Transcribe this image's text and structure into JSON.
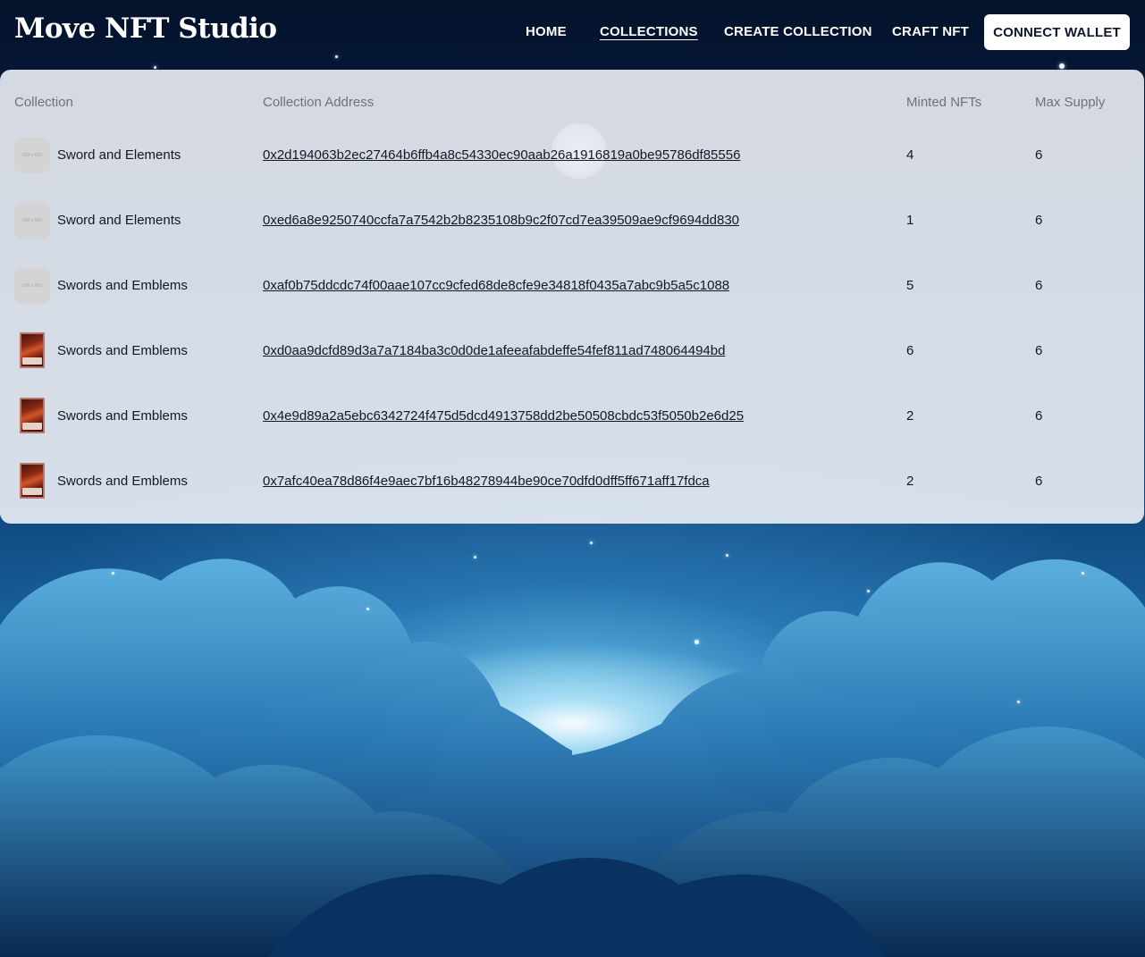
{
  "app": {
    "title": "Move NFT Studio"
  },
  "nav": {
    "home": "HOME",
    "collections": "COLLECTIONS",
    "create_collection": "CREATE COLLECTION",
    "craft_nft": "CRAFT NFT",
    "connect_wallet": "CONNECT WALLET",
    "active": "COLLECTIONS"
  },
  "table": {
    "headers": {
      "collection": "Collection",
      "address": "Collection Address",
      "minted": "Minted NFTs",
      "max_supply": "Max Supply"
    },
    "placeholder_text": "600 x 600",
    "rows": [
      {
        "name": "Sword and Elements",
        "address": "0x2d194063b2ec27464b6ffb4a8c54330ec90aab26a1916819a0be95786df85556",
        "minted": "4",
        "max_supply": "6",
        "image": "placeholder"
      },
      {
        "name": "Sword and Elements",
        "address": "0xed6a8e9250740ccfa7a7542b2b8235108b9c2f07cd7ea39509ae9cf9694dd830",
        "minted": "1",
        "max_supply": "6",
        "image": "placeholder"
      },
      {
        "name": "Swords and Emblems",
        "address": "0xaf0b75ddcdc74f00aae107cc9cfed68de8cfe9e34818f0435a7abc9b5a5c1088",
        "minted": "5",
        "max_supply": "6",
        "image": "placeholder"
      },
      {
        "name": "Swords and Emblems",
        "address": "0xd0aa9dcfd89d3a7a7184ba3c0d0de1afeeafabdeffe54fef811ad748064494bd",
        "minted": "6",
        "max_supply": "6",
        "image": "card-art"
      },
      {
        "name": "Swords and Emblems",
        "address": "0x4e9d89a2a5ebc6342724f475d5dcd4913758dd2be50508cbdc53f5050b2e6d25",
        "minted": "2",
        "max_supply": "6",
        "image": "card-art"
      },
      {
        "name": "Swords and Emblems",
        "address": "0x7afc40ea78d86f4e9aec7bf16b48278944be90ce70dfd0dff5ff671aff17fdca",
        "minted": "2",
        "max_supply": "6",
        "image": "card-art"
      }
    ]
  }
}
